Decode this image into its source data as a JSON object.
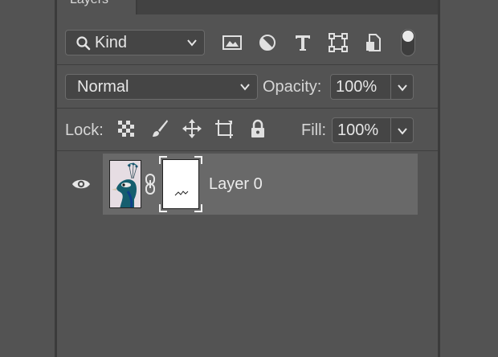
{
  "panel": {
    "tab_label": "Layers"
  },
  "filter": {
    "kind_label": "Kind",
    "icons": [
      "image-filter-icon",
      "adjustment-filter-icon",
      "type-filter-icon",
      "shape-filter-icon",
      "smart-object-filter-icon"
    ],
    "toggle": "on"
  },
  "blend": {
    "mode": "Normal",
    "opacity_label": "Opacity:",
    "opacity_value": "100%"
  },
  "lock": {
    "label": "Lock:",
    "icons": [
      "lock-transparent-pixels-icon",
      "lock-image-pixels-icon",
      "lock-position-icon",
      "lock-artboard-icon",
      "lock-all-icon"
    ],
    "fill_label": "Fill:",
    "fill_value": "100%"
  },
  "layers": [
    {
      "name": "Layer 0",
      "visible": true,
      "has_mask": true,
      "linked": true
    }
  ],
  "colors": {
    "panel_bg": "#535353",
    "selected_row": "#696969",
    "text": "#d9d9d9"
  }
}
